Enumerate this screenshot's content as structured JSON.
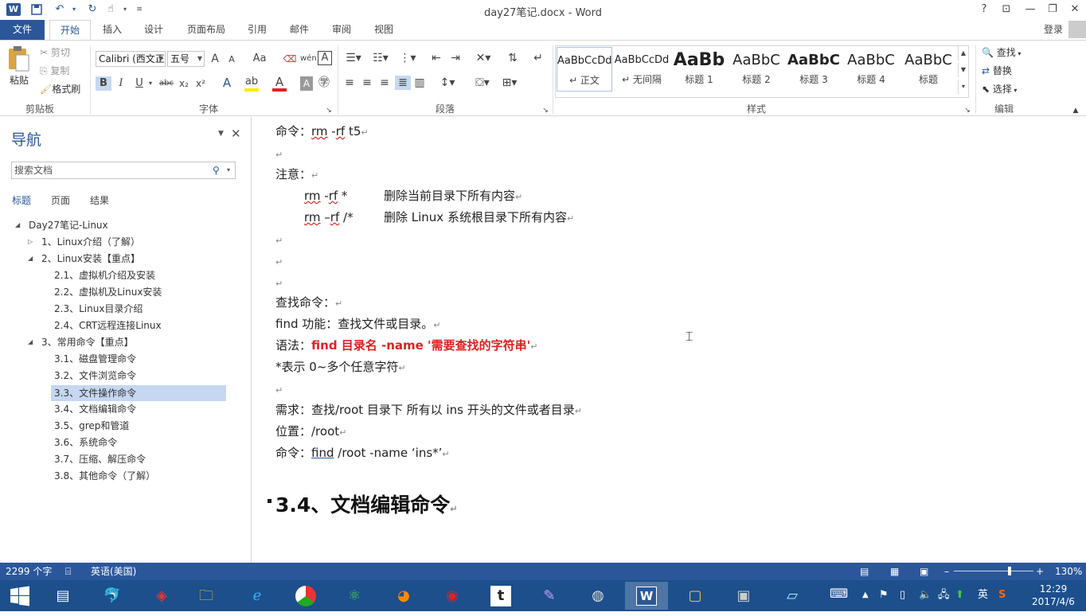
{
  "window": {
    "title": "day27笔记.docx - Word",
    "help": "?",
    "login": "登录"
  },
  "quick_access": {
    "word_icon": "W",
    "save_icon": "save-icon",
    "undo_icon": "undo-icon",
    "redo_icon": "redo-icon",
    "touch_icon": "touch-icon",
    "customize_icon": "customize-icon"
  },
  "ribbon_tabs": [
    "文件",
    "开始",
    "插入",
    "设计",
    "页面布局",
    "引用",
    "邮件",
    "审阅",
    "视图"
  ],
  "clipboard": {
    "paste": "粘贴",
    "cut": "剪切",
    "copy": "复制",
    "format_painter": "格式刷",
    "label": "剪贴板"
  },
  "font": {
    "name": "Calibri (西文正",
    "size": "五号",
    "grow": "A",
    "shrink": "A",
    "case": "Aa",
    "bold": "B",
    "italic": "I",
    "underline": "U",
    "strike": "abc",
    "sub": "x₂",
    "sup": "x²",
    "label": "字体"
  },
  "paragraph": {
    "label": "段落"
  },
  "styles": {
    "items": [
      {
        "preview": "AaBbCcDd",
        "name": "↵ 正文"
      },
      {
        "preview": "AaBbCcDd",
        "name": "↵ 无间隔"
      },
      {
        "preview": "AaBb",
        "name": "标题 1"
      },
      {
        "preview": "AaBbC",
        "name": "标题 2"
      },
      {
        "preview": "AaBbC",
        "name": "标题 3"
      },
      {
        "preview": "AaBbC",
        "name": "标题 4"
      },
      {
        "preview": "AaBbC",
        "name": "标题"
      }
    ],
    "label": "样式"
  },
  "editing": {
    "find": "查找",
    "replace": "替换",
    "select": "选择",
    "label": "编辑"
  },
  "nav": {
    "title": "导航",
    "search_placeholder": "搜索文档",
    "tabs": [
      "标题",
      "页面",
      "结果"
    ],
    "tree": [
      {
        "label": "Day27笔记-Linux"
      },
      {
        "label": "1、Linux介绍（了解）"
      },
      {
        "label": "2、Linux安装【重点】"
      },
      {
        "label": "2.1、虚拟机介绍及安装"
      },
      {
        "label": "2.2、虚拟机及Linux安装"
      },
      {
        "label": "2.3、Linux目录介绍"
      },
      {
        "label": "2.4、CRT远程连接Linux"
      },
      {
        "label": "3、常用命令【重点】"
      },
      {
        "label": "3.1、磁盘管理命令"
      },
      {
        "label": "3.2、文件浏览命令"
      },
      {
        "label": "3.3、文件操作命令"
      },
      {
        "label": "3.4、文档编辑命令"
      },
      {
        "label": "3.5、grep和管道"
      },
      {
        "label": "3.6、系统命令"
      },
      {
        "label": "3.7、压缩、解压命令"
      },
      {
        "label": "3.8、其他命令（了解）"
      }
    ]
  },
  "document": {
    "l1_a": "命令：",
    "l1_b": "rm",
    "l1_c": " -",
    "l1_d": "rf",
    "l1_e": " t5",
    "l3": "注意：",
    "l4_a": "rm",
    "l4_b": " -",
    "l4_c": "rf",
    "l4_d": " *",
    "l4_e": "删除当前目录下所有内容",
    "l5_a": "rm",
    "l5_b": " –",
    "l5_c": "rf",
    "l5_d": " /*",
    "l5_e": "删除 Linux 系统根目录下所有内容",
    "l9": "查找命令：",
    "l10": "find 功能：查找文件或目录。",
    "l11_a": "语法：",
    "l11_b": "find  目录名  -name '需要查找的字符串'",
    "l12": "*表示 0~多个任意字符",
    "l14": "需求：查找/root 目录下  所有以 ins 开头的文件或者目录",
    "l15": "位置：/root",
    "l16_a": "命令：",
    "l16_b": "find",
    "l16_c": " /root -name ‘ins*’",
    "heading": "3.4、文档编辑命令",
    "para_mark": "↵"
  },
  "status": {
    "word_count": "2299 个字",
    "language": "英语(美国)",
    "zoom": "130%",
    "zoom_level": 0.7
  },
  "taskbar": {
    "time": "12:29",
    "date": "2017/4/6",
    "ime": "英"
  },
  "colors": {
    "accent": "#2b579a",
    "taskbar": "#1c4f8c",
    "red_text": "#e02020",
    "nav_selected": "#c5d7f1"
  }
}
